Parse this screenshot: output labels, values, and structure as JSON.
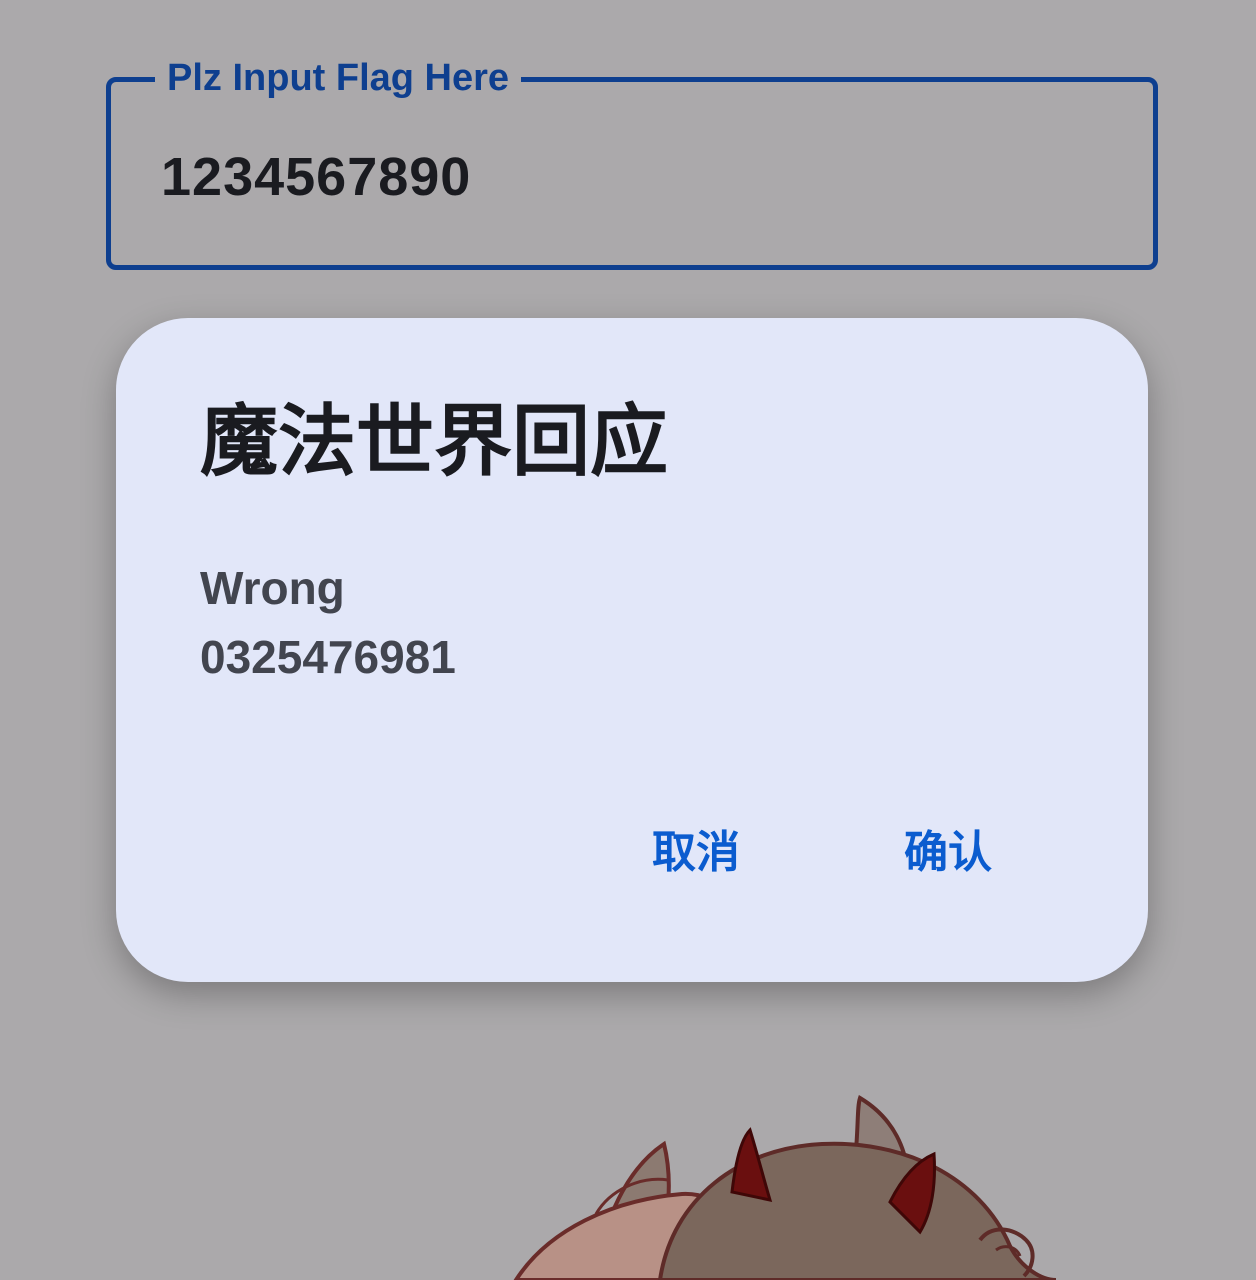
{
  "flag_input": {
    "label": "Plz Input Flag Here",
    "value": "1234567890"
  },
  "dialog": {
    "title": "魔法世界回应",
    "message": "Wrong\n0325476981",
    "cancel_label": "取消",
    "confirm_label": "确认"
  },
  "colors": {
    "background": "#aba9ab",
    "field_border": "#0e3f8f",
    "dialog_surface": "#e2e7f9",
    "button_text": "#0b5ccf",
    "title_text": "#1a1b20",
    "message_text": "#42454f"
  },
  "illustration": {
    "name": "mascot-character-partial"
  }
}
